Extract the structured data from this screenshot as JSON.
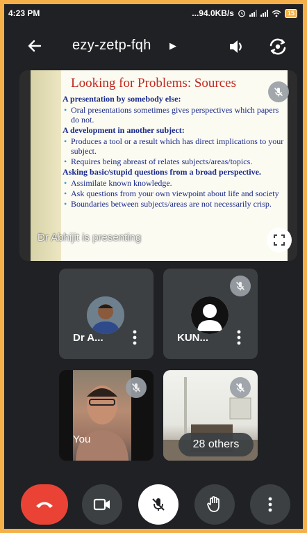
{
  "status_bar": {
    "time": "4:23 PM",
    "network_speed": "...94.0KB/s",
    "battery": "15"
  },
  "meeting": {
    "code": "ezy-zetp-fqh"
  },
  "presentation": {
    "presenter_text": "Dr Abhijit is presenting",
    "slide": {
      "title": "Looking for Problems: Sources",
      "sections": [
        {
          "heading": "A presentation by somebody else:",
          "bullets": [
            "Oral presentations sometimes gives  perspectives which papers do not."
          ]
        },
        {
          "heading": "A development in another subject:",
          "bullets": [
            "Produces a tool or a result which has direct implications to your subject.",
            "Requires being abreast of relates subjects/areas/topics."
          ]
        },
        {
          "heading": "Asking basic/stupid questions from a broad perspective.",
          "bullets": [
            "Assimilate known knowledge.",
            "Ask questions from your own viewpoint about life and society",
            "Boundaries between subjects/areas are not necessarily crisp."
          ]
        }
      ]
    }
  },
  "participants": [
    {
      "name": "Dr A..."
    },
    {
      "name": "KUN..."
    },
    {
      "name": "You"
    },
    {
      "others": "28 others"
    }
  ],
  "colors": {
    "background": "#202124",
    "tile": "#3c4043",
    "end_call": "#ea4335",
    "slide_title": "#c0271d",
    "slide_text": "#1a2a8c"
  }
}
